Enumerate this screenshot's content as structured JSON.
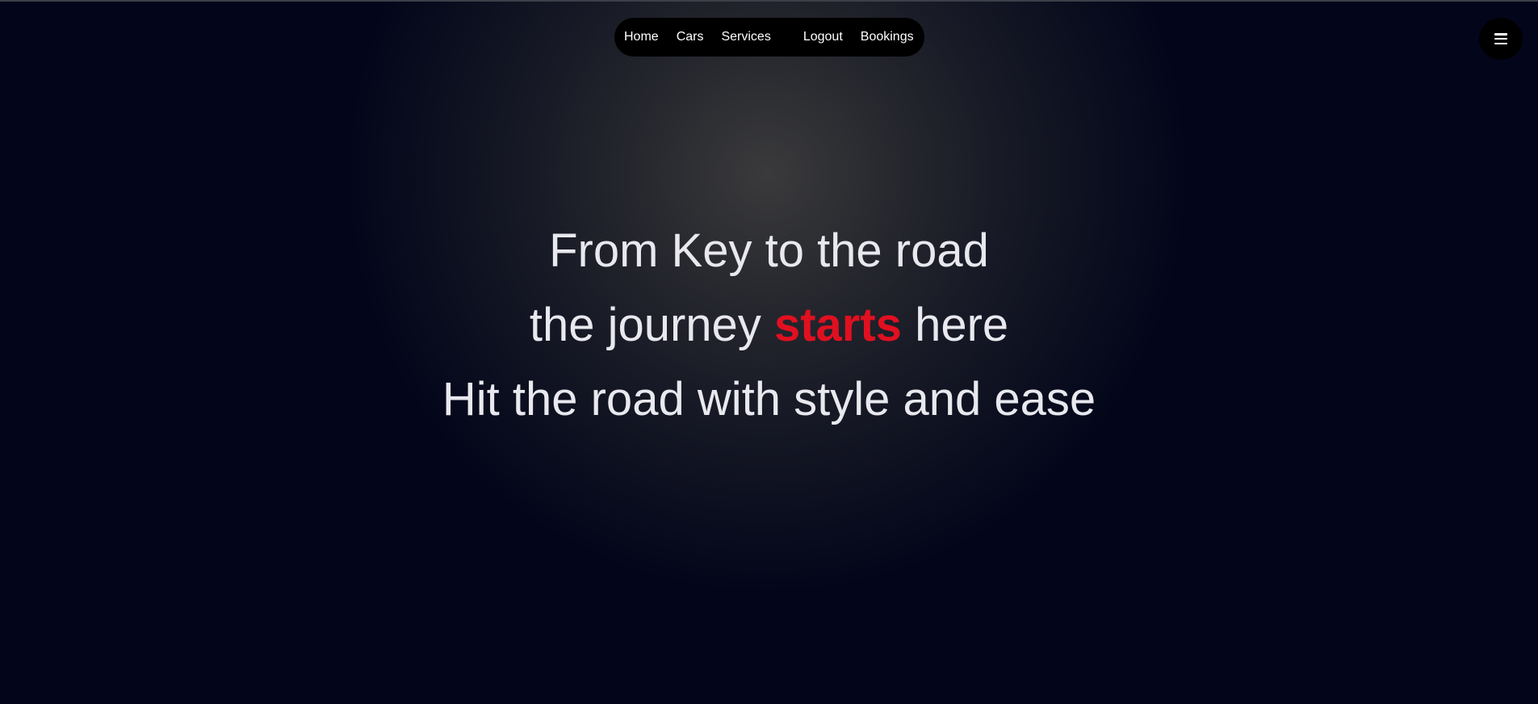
{
  "nav": {
    "items": [
      {
        "label": "Home"
      },
      {
        "label": "Cars"
      },
      {
        "label": "Services"
      },
      {
        "label": "Logout"
      },
      {
        "label": "Bookings"
      }
    ]
  },
  "menu_button": {
    "icon": "hamburger-menu-icon"
  },
  "hero": {
    "line1": "From Key to the road",
    "line2_before": "the journey",
    "line2_accent": "starts",
    "line2_after": "here",
    "line3": "Hit the road with style and ease"
  },
  "colors": {
    "background": "#03061a",
    "accent": "#e01020",
    "text": "#e8e8ee",
    "nav_background": "#000000"
  }
}
